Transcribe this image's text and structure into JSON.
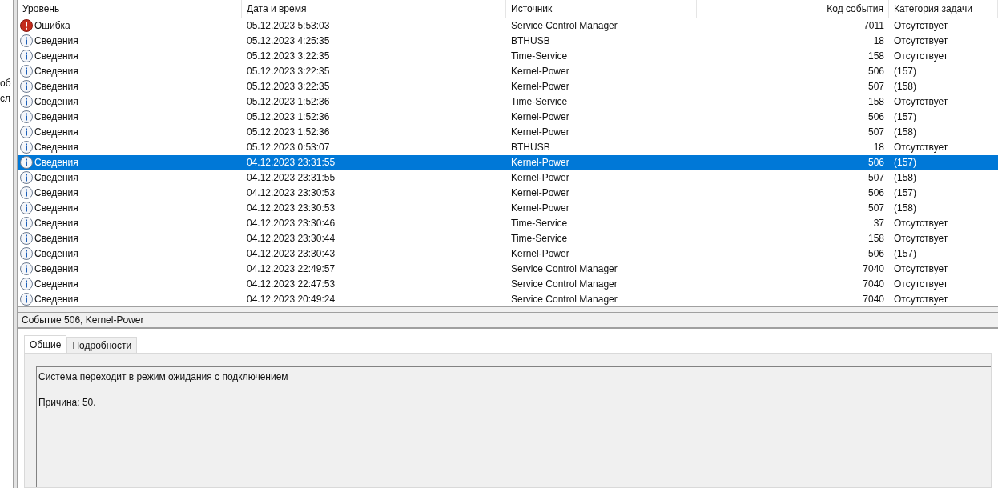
{
  "left_pane": {
    "fragments": [
      "об",
      "сл"
    ]
  },
  "table": {
    "columns": [
      "Уровень",
      "Дата и время",
      "Источник",
      "Код события",
      "Категория задачи"
    ],
    "rows": [
      {
        "kind": "error",
        "level": "Ошибка",
        "date": "05.12.2023 5:53:03",
        "source": "Service Control Manager",
        "code": "7011",
        "category": "Отсутствует",
        "selected": false
      },
      {
        "kind": "info",
        "level": "Сведения",
        "date": "05.12.2023 4:25:35",
        "source": "BTHUSB",
        "code": "18",
        "category": "Отсутствует",
        "selected": false
      },
      {
        "kind": "info",
        "level": "Сведения",
        "date": "05.12.2023 3:22:35",
        "source": "Time-Service",
        "code": "158",
        "category": "Отсутствует",
        "selected": false
      },
      {
        "kind": "info",
        "level": "Сведения",
        "date": "05.12.2023 3:22:35",
        "source": "Kernel-Power",
        "code": "506",
        "category": "(157)",
        "selected": false
      },
      {
        "kind": "info",
        "level": "Сведения",
        "date": "05.12.2023 3:22:35",
        "source": "Kernel-Power",
        "code": "507",
        "category": "(158)",
        "selected": false
      },
      {
        "kind": "info",
        "level": "Сведения",
        "date": "05.12.2023 1:52:36",
        "source": "Time-Service",
        "code": "158",
        "category": "Отсутствует",
        "selected": false
      },
      {
        "kind": "info",
        "level": "Сведения",
        "date": "05.12.2023 1:52:36",
        "source": "Kernel-Power",
        "code": "506",
        "category": "(157)",
        "selected": false
      },
      {
        "kind": "info",
        "level": "Сведения",
        "date": "05.12.2023 1:52:36",
        "source": "Kernel-Power",
        "code": "507",
        "category": "(158)",
        "selected": false
      },
      {
        "kind": "info",
        "level": "Сведения",
        "date": "05.12.2023 0:53:07",
        "source": "BTHUSB",
        "code": "18",
        "category": "Отсутствует",
        "selected": false
      },
      {
        "kind": "info",
        "level": "Сведения",
        "date": "04.12.2023 23:31:55",
        "source": "Kernel-Power",
        "code": "506",
        "category": "(157)",
        "selected": true
      },
      {
        "kind": "info",
        "level": "Сведения",
        "date": "04.12.2023 23:31:55",
        "source": "Kernel-Power",
        "code": "507",
        "category": "(158)",
        "selected": false
      },
      {
        "kind": "info",
        "level": "Сведения",
        "date": "04.12.2023 23:30:53",
        "source": "Kernel-Power",
        "code": "506",
        "category": "(157)",
        "selected": false
      },
      {
        "kind": "info",
        "level": "Сведения",
        "date": "04.12.2023 23:30:53",
        "source": "Kernel-Power",
        "code": "507",
        "category": "(158)",
        "selected": false
      },
      {
        "kind": "info",
        "level": "Сведения",
        "date": "04.12.2023 23:30:46",
        "source": "Time-Service",
        "code": "37",
        "category": "Отсутствует",
        "selected": false
      },
      {
        "kind": "info",
        "level": "Сведения",
        "date": "04.12.2023 23:30:44",
        "source": "Time-Service",
        "code": "158",
        "category": "Отсутствует",
        "selected": false
      },
      {
        "kind": "info",
        "level": "Сведения",
        "date": "04.12.2023 23:30:43",
        "source": "Kernel-Power",
        "code": "506",
        "category": "(157)",
        "selected": false
      },
      {
        "kind": "info",
        "level": "Сведения",
        "date": "04.12.2023 22:49:57",
        "source": "Service Control Manager",
        "code": "7040",
        "category": "Отсутствует",
        "selected": false
      },
      {
        "kind": "info",
        "level": "Сведения",
        "date": "04.12.2023 22:47:53",
        "source": "Service Control Manager",
        "code": "7040",
        "category": "Отсутствует",
        "selected": false
      },
      {
        "kind": "info",
        "level": "Сведения",
        "date": "04.12.2023 20:49:24",
        "source": "Service Control Manager",
        "code": "7040",
        "category": "Отсутствует",
        "selected": false
      }
    ]
  },
  "details": {
    "title": "Событие 506, Kernel-Power",
    "tabs": [
      {
        "label": "Общие",
        "selected": true
      },
      {
        "label": "Подробности",
        "selected": false
      }
    ],
    "lines": [
      "Система переходит в режим ожидания с подключением",
      "Причина: 50."
    ]
  }
}
